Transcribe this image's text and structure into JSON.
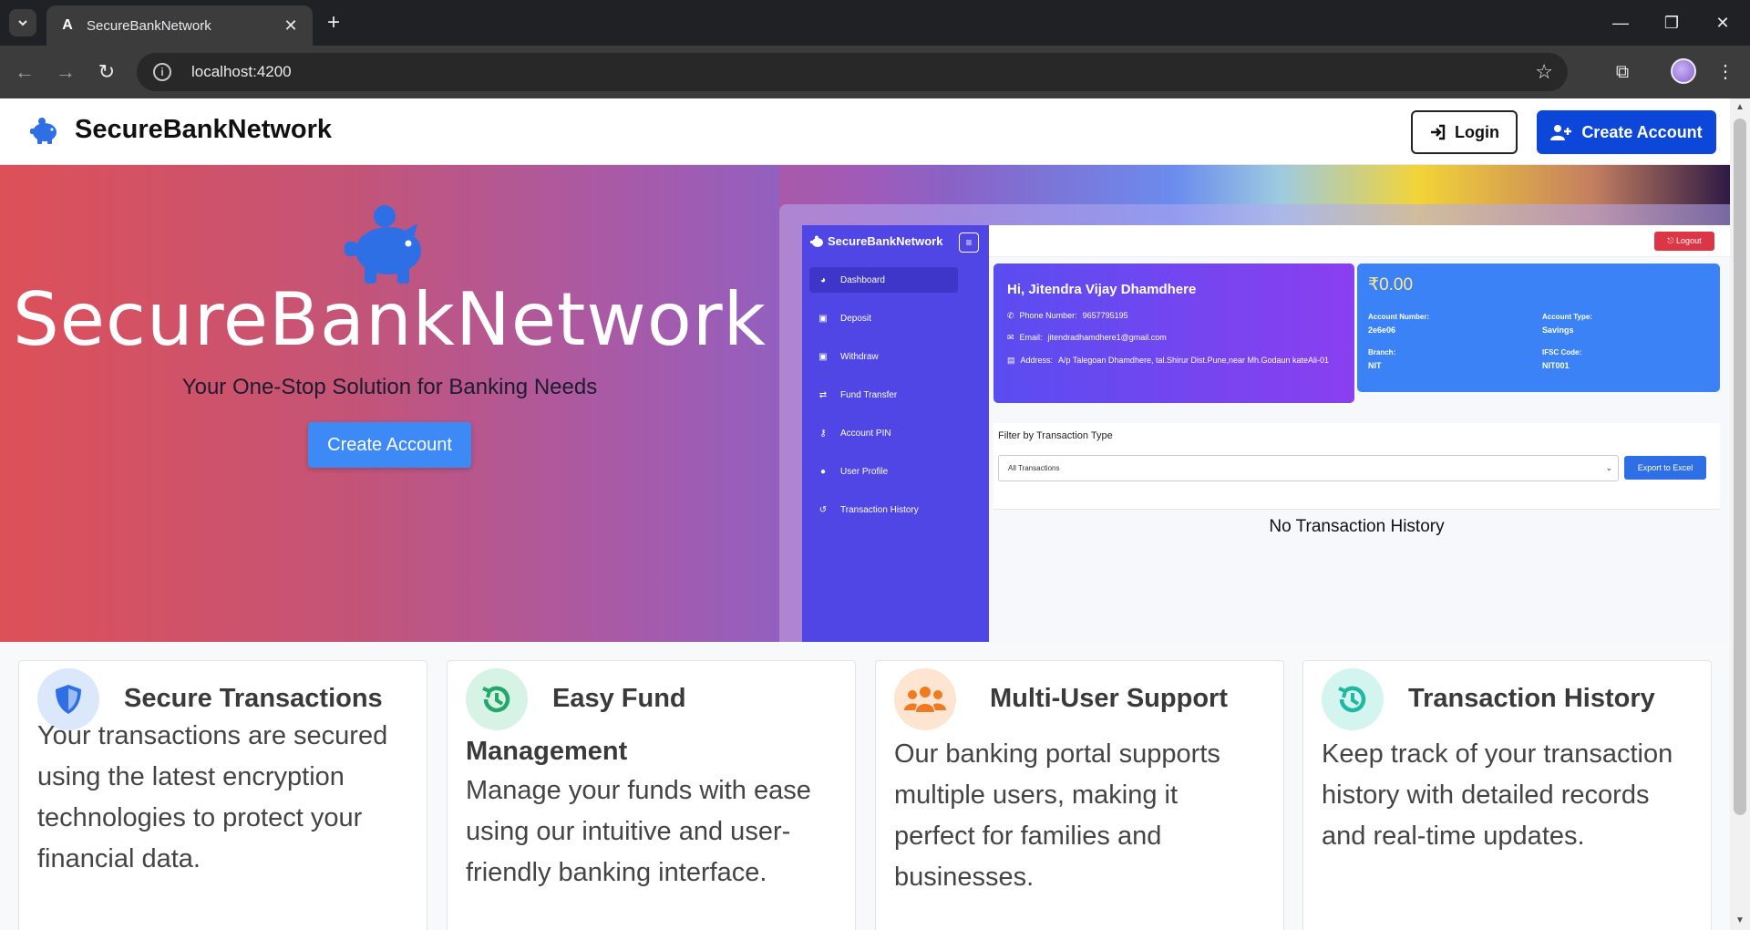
{
  "browser": {
    "tab_title": "SecureBankNetwork",
    "url": "localhost:4200"
  },
  "navbar": {
    "brand": "SecureBankNetwork",
    "login_label": "Login",
    "create_label": "Create Account"
  },
  "hero": {
    "title": "SecureBankNetwork",
    "subtitle": "Your One-Stop Solution for Banking Needs",
    "button_label": "Create Account"
  },
  "mock": {
    "brand": "SecureBankNetwork",
    "logout_label": "Logout",
    "nav": [
      {
        "label": "Dashboard",
        "icon": "dashboard-icon"
      },
      {
        "label": "Deposit",
        "icon": "money-icon"
      },
      {
        "label": "Withdraw",
        "icon": "money-icon"
      },
      {
        "label": "Fund Transfer",
        "icon": "exchange-icon"
      },
      {
        "label": "Account PIN",
        "icon": "key-icon"
      },
      {
        "label": "User Profile",
        "icon": "user-icon"
      },
      {
        "label": "Transaction History",
        "icon": "history-icon"
      }
    ],
    "profile": {
      "greeting": "Hi, Jitendra Vijay Dhamdhere",
      "phone_label": "Phone Number:",
      "phone": "9657795195",
      "email_label": "Email:",
      "email": "jitendradhamdhere1@gmail.com",
      "address_label": "Address:",
      "address": "A/p Talegoan Dhamdhere, tal.Shirur Dist.Pune,near Mh.Godaun kateAli-01"
    },
    "account": {
      "balance": "₹0.00",
      "account_number_label": "Account Number:",
      "account_number": "2e6e06",
      "account_type_label": "Account Type:",
      "account_type": "Savings",
      "branch_label": "Branch:",
      "branch": "NIT",
      "ifsc_label": "IFSC Code:",
      "ifsc": "NIT001"
    },
    "filter_label": "Filter by Transaction Type",
    "filter_value": "All Transactions",
    "export_label": "Export to Excel",
    "empty_text": "No Transaction History"
  },
  "features": [
    {
      "title_line1": "Secure Transactions",
      "title_line2": "",
      "text": "Your transactions are secured using the latest encryption technologies to protect your financial data.",
      "icon": "shield-icon",
      "color": "#2f6fe6",
      "bg": "#dbe7fb"
    },
    {
      "title_line1": "Easy Fund",
      "title_line2": "Management",
      "text": "Manage your funds with ease using our intuitive and user-friendly banking interface.",
      "icon": "history-icon",
      "color": "#22a86a",
      "bg": "#d7f3e5"
    },
    {
      "title_line1": "Multi-User Support",
      "title_line2": "",
      "text": "Our banking portal supports multiple users, making it perfect for families and businesses.",
      "icon": "users-icon",
      "color": "#f07a22",
      "bg": "#fde5d2"
    },
    {
      "title_line1": "Transaction History",
      "title_line2": "",
      "text": "Keep track of your transaction history with detailed records and real-time updates.",
      "icon": "history-icon",
      "color": "#1fb9a3",
      "bg": "#d3f4ef"
    }
  ]
}
